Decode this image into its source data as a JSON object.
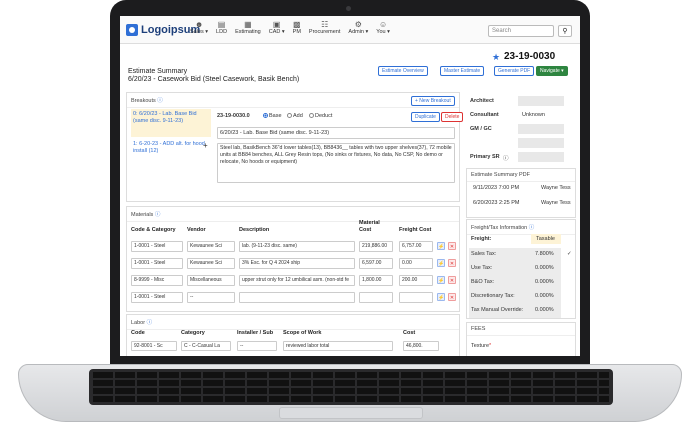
{
  "app": {
    "logo": "Logoipsum"
  },
  "nav": [
    {
      "label": "Sales ▾",
      "icon": "users-icon"
    },
    {
      "label": "LDD",
      "icon": "document-icon"
    },
    {
      "label": "Estimating",
      "icon": "calculator-icon"
    },
    {
      "label": "CAD ▾",
      "icon": "cube-icon"
    },
    {
      "label": "PM",
      "icon": "briefcase-icon"
    },
    {
      "label": "Procurement",
      "icon": "cart-icon"
    },
    {
      "label": "Admin ▾",
      "icon": "gear-icon"
    },
    {
      "label": "You ▾",
      "icon": "user-icon"
    }
  ],
  "search": {
    "placeholder": "Search"
  },
  "header": {
    "estimate_number": "23-19-0030",
    "title": "Estimate Summary",
    "subtitle": "6/20/23 - Casework Bid (Steel Casework, Basik Bench)",
    "buttons": [
      "Estimate Overview",
      "Master Estimate",
      "Generate PDF",
      "Navigate ▾"
    ]
  },
  "breakouts": {
    "title": "Breakouts",
    "new_button": "+ New Breakout",
    "items": [
      {
        "text": "0: 6/20/23 - Lab. Base Bid (same disc. 9-11-23)"
      },
      {
        "text": "1: 6-20-23 - ADD alt. for hood install (12)"
      }
    ],
    "number": "23-19-0030.0",
    "options": [
      "Base",
      "Add",
      "Deduct"
    ],
    "duplicate": "Duplicate",
    "delete": "Delete",
    "name": "6/20/23 - Lab. Base Bid (same disc. 9-11-23)",
    "description": "Steel lab, BasikBench 36\"d lower tables(13), BB8436__ tables with two upper shelves(37), 72 mobile units at BB84 benches, ALL Grey Resin tops, (No sinks or fixtures, No data, No CSP, No demo or relocate, No hoods or equipment)"
  },
  "materials": {
    "title": "Materials",
    "headers": [
      "Code & Category",
      "Vendor",
      "Description",
      "Material Cost",
      "Freight Cost"
    ],
    "rows": [
      {
        "code": "1-0001 - Steel",
        "vendor": "Kewaunee Sci",
        "desc": "lab. (9-11-23 disc. same)",
        "mat": "219,886.00",
        "frt": "6,757.00"
      },
      {
        "code": "1-0001 - Steel",
        "vendor": "Kewaunee Sci",
        "desc": "3% Esc. for Q 4 2024 ship",
        "mat": "6,597.00",
        "frt": "0.00"
      },
      {
        "code": "8-9999 - Misc",
        "vendor": "Miscellaneous",
        "desc": "upper strut only for 12 umbilical asm. (non-std fe",
        "mat": "1,800.00",
        "frt": "200.00"
      },
      {
        "code": "1-0001 - Steel",
        "vendor": "--",
        "desc": "",
        "mat": "",
        "frt": ""
      }
    ]
  },
  "labor": {
    "title": "Labor",
    "headers": [
      "Code",
      "Category",
      "Installer / Sub",
      "Scope of Work",
      "Cost"
    ],
    "row": {
      "code": "92-8001 - Sc",
      "category": "C - C-Casual La",
      "installer": "--",
      "scope": "reviewed labor total",
      "cost": "46,800."
    }
  },
  "contacts": {
    "labels": [
      "Architect",
      "Consultant",
      "GM / GC",
      "Primary SR"
    ],
    "consultant_value": "Unknown"
  },
  "pdf": {
    "title": "Estimate Summary PDF",
    "rows": [
      {
        "date": "9/11/2023 7:00 PM",
        "user": "Wayne Tess"
      },
      {
        "date": "6/20/2023 2:25 PM",
        "user": "Wayne Tess"
      }
    ]
  },
  "freight": {
    "title": "Freight/Tax Information",
    "freight_label": "Freight:",
    "freight_value": "Taxable",
    "taxes": [
      {
        "label": "Sales Tax:",
        "value": "7.800%"
      },
      {
        "label": "Use Tax:",
        "value": "0.000%"
      },
      {
        "label": "B&O Tax:",
        "value": "0.000%"
      },
      {
        "label": "Discretionary Tax:",
        "value": "0.000%"
      },
      {
        "label": "Tax Manual Override:",
        "value": "0.000%"
      }
    ]
  },
  "fees": {
    "title": "FEES",
    "texture_label": "Texture"
  }
}
